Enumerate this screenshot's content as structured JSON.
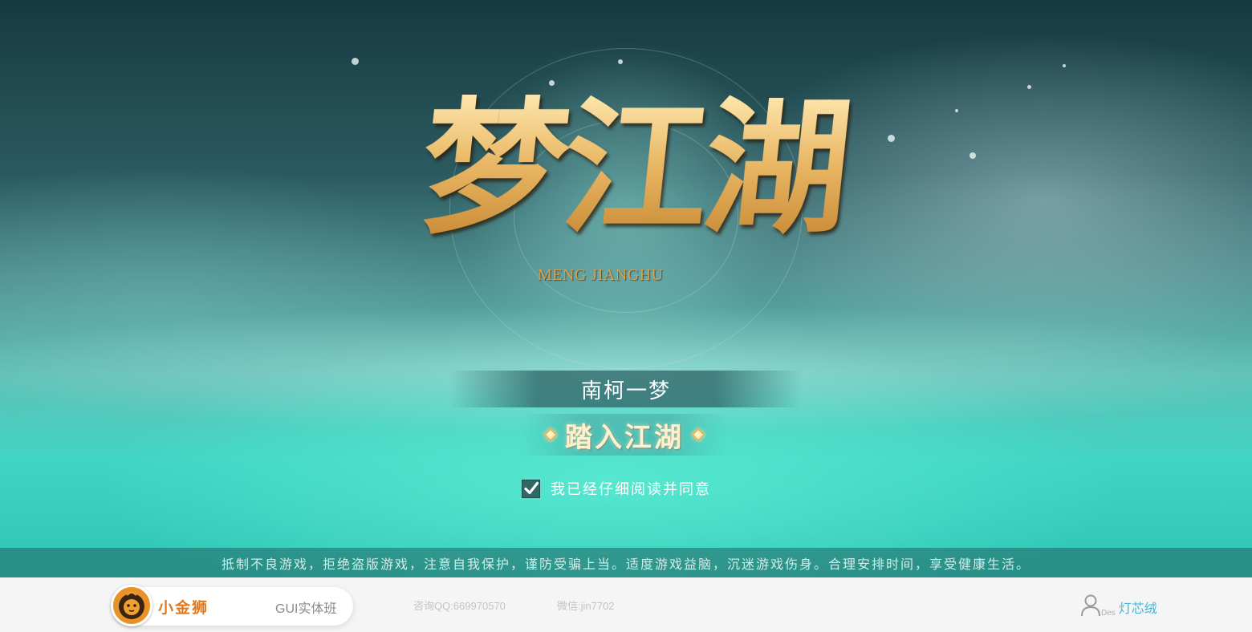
{
  "game": {
    "logo_title": "梦江湖",
    "logo_subtitle": "MENG JIANGHU"
  },
  "login": {
    "server_name": "南柯一梦",
    "enter_button": "踏入江湖",
    "agreement_text": "我已经仔细阅读并同意",
    "agreement_checked": true
  },
  "notice": {
    "text": "抵制不良游戏，拒绝盗版游戏，注意自我保护，谨防受骗上当。适度游戏益脑，沉迷游戏伤身。合理安排时间，享受健康生活。"
  },
  "footer": {
    "brand_name": "小金狮",
    "course": "GUI实体班",
    "qq": "咨询QQ:669970570",
    "wechat": "微信:jin7702",
    "des_tag": "Des",
    "designer": "灯芯绒"
  },
  "colors": {
    "logo_gold": "#e7b45a",
    "brand_orange": "#e0781f",
    "designer_blue": "#45b7d6"
  },
  "icons": [
    "lion-logo-icon",
    "checkmark-icon",
    "diamond-icon",
    "user-icon"
  ]
}
